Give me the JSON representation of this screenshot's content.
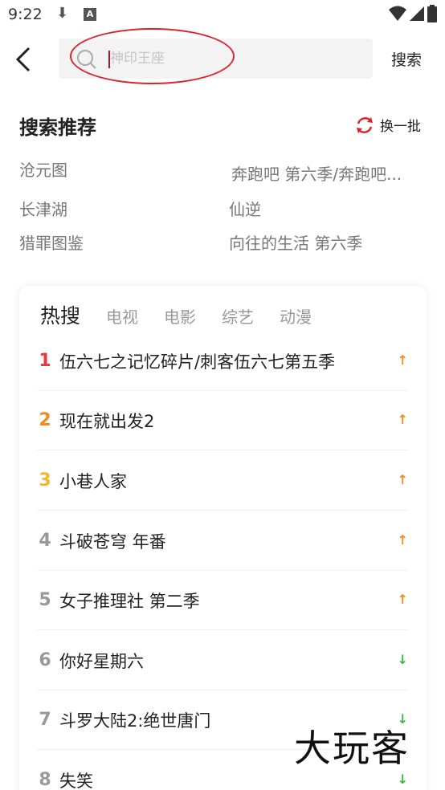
{
  "status_bar": {
    "time": "9:22",
    "download_icon": "download-icon",
    "notification_icon": "a-app-icon"
  },
  "header": {
    "back_icon": "back-arrow-icon",
    "search_placeholder": "神印王座",
    "search_button": "搜索"
  },
  "recommend": {
    "title": "搜索推荐",
    "refresh_label": "换一批",
    "items": [
      "沧元图",
      "奔跑吧 第六季/奔跑吧...",
      "长津湖",
      "仙逆",
      "猎罪图鉴",
      "向往的生活 第六季"
    ]
  },
  "hot": {
    "tabs": [
      "热搜",
      "电视",
      "电影",
      "综艺",
      "动漫"
    ],
    "list": [
      {
        "rank": "1",
        "title": "伍六七之记忆碎片/刺客伍六七第五季",
        "trend": "↑",
        "rank_color": "#e8383d",
        "trend_color": "#f08a24"
      },
      {
        "rank": "2",
        "title": "现在就出发2",
        "trend": "↑",
        "rank_color": "#f08a24",
        "trend_color": "#f08a24"
      },
      {
        "rank": "3",
        "title": "小巷人家",
        "trend": "↑",
        "rank_color": "#f5b52d",
        "trend_color": "#f08a24"
      },
      {
        "rank": "4",
        "title": "斗破苍穹 年番",
        "trend": "↑",
        "rank_color": "#999999",
        "trend_color": "#f08a24"
      },
      {
        "rank": "5",
        "title": "女子推理社 第二季",
        "trend": "↑",
        "rank_color": "#999999",
        "trend_color": "#f08a24"
      },
      {
        "rank": "6",
        "title": "你好星期六",
        "trend": "↓",
        "rank_color": "#999999",
        "trend_color": "#3bb54a"
      },
      {
        "rank": "7",
        "title": "斗罗大陆2:绝世唐门",
        "trend": "↓",
        "rank_color": "#999999",
        "trend_color": "#3bb54a"
      },
      {
        "rank": "8",
        "title": "失笑",
        "trend": "↓",
        "rank_color": "#999999",
        "trend_color": "#3bb54a"
      }
    ]
  },
  "watermark": "大玩客"
}
